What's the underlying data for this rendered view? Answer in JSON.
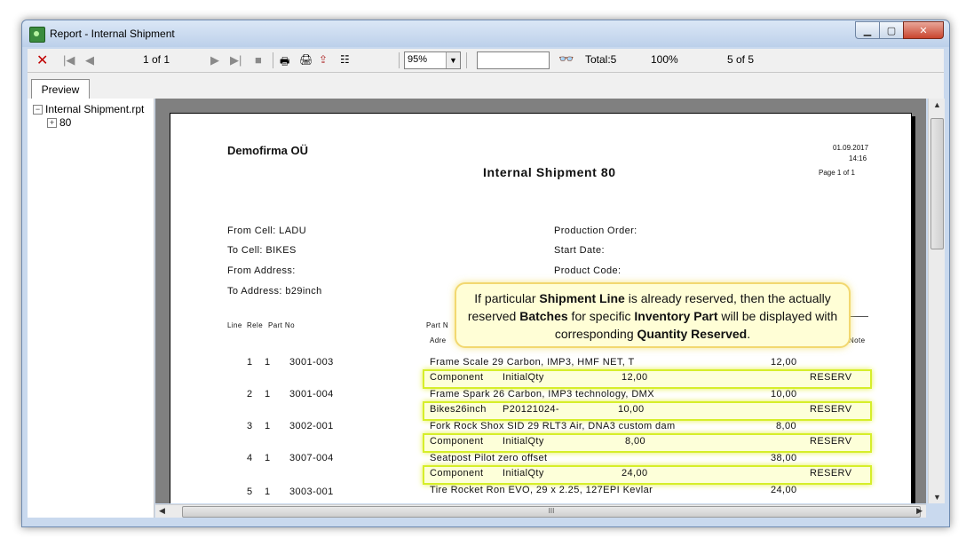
{
  "window": {
    "title": "Report - Internal Shipment"
  },
  "toolbar": {
    "close_label": "✕",
    "first": "|◀",
    "prev": "◀",
    "page": "1 of 1",
    "next": "▶",
    "last": "▶|",
    "stop": "■",
    "zoom": "95%",
    "total": "Total:5",
    "percent": "100%",
    "count": "5 of 5"
  },
  "tab": {
    "preview": "Preview"
  },
  "tree": {
    "root": "Internal Shipment.rpt",
    "child": "80"
  },
  "report": {
    "company": "Demofirma OÜ",
    "title": "Internal Shipment  80",
    "date": "01.09.2017",
    "time": "14:16",
    "page": "Page 1 of 1",
    "from_cell": "From Cell: LADU",
    "to_cell": "To Cell: BIKES",
    "from_address": "From Address:",
    "to_address": "To Address: b29inch",
    "production_order": "Production Order:",
    "start_date": "Start Date:",
    "product_code": "Product Code:",
    "col_line": "Line",
    "col_rele": "Rele",
    "col_partno": "Part No",
    "col_partname": "Part N",
    "col_adress": "Adre",
    "col_note": "Note",
    "rows": [
      {
        "line": "1",
        "rele": "1",
        "part": "3001-003",
        "desc": "Frame Scale 29 Carbon, IMP3, HMF NET, T",
        "qty": "12,00",
        "sub_a": "Component",
        "sub_b": "InitialQty",
        "sub_qty": "12,00",
        "status": "RESERV"
      },
      {
        "line": "2",
        "rele": "1",
        "part": "3001-004",
        "desc": "Frame Spark 26 Carbon, IMP3 technology, DMX",
        "qty": "10,00",
        "sub_a": "Bikes26inch",
        "sub_b": "P20121024-",
        "sub_qty": "10,00",
        "status": "RESERV"
      },
      {
        "line": "3",
        "rele": "1",
        "part": "3002-001",
        "desc": "Fork Rock Shox SID 29 RLT3 Air, DNA3 custom dam",
        "qty": "8,00",
        "sub_a": "Component",
        "sub_b": "InitialQty",
        "sub_qty": "8,00",
        "status": "RESERV"
      },
      {
        "line": "4",
        "rele": "1",
        "part": "3007-004",
        "desc": "Seatpost Pilot zero offset",
        "qty": "38,00",
        "sub_a": "Component",
        "sub_b": "InitialQty",
        "sub_qty": "24,00",
        "status": "RESERV"
      },
      {
        "line": "5",
        "rele": "1",
        "part": "3003-001",
        "desc": "Tire Rocket Ron EVO, 29 x 2.25, 127EPI Kevlar",
        "qty": "24,00"
      }
    ]
  },
  "callout": {
    "t1": "If particular ",
    "b1": "Shipment Line",
    "t2": " is already reserved, then the actually reserved ",
    "b2": "Batches",
    "t3": " for specific ",
    "b3": "Inventory Part",
    "t4": " will be displayed with corresponding ",
    "b4": "Quantity Reserved",
    "t5": "."
  },
  "scroll": {
    "hthumb": "III"
  },
  "colors": {
    "highlight": "#d6ee2a",
    "callout_bg": "#fffed6",
    "close_red": "#c00000"
  }
}
